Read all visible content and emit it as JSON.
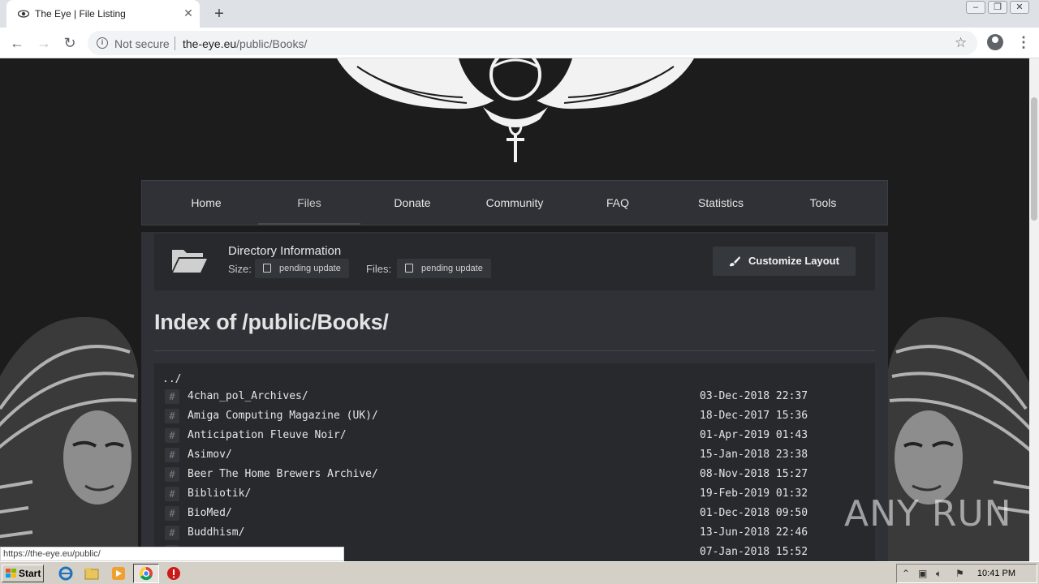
{
  "browser": {
    "tab_title": "The Eye | File Listing",
    "tab_close": "✕",
    "new_tab": "+",
    "address": {
      "security_label": "Not secure",
      "host": "the-eye.eu",
      "path": "/public/Books/"
    },
    "status_url": "https://the-eye.eu/public/"
  },
  "site": {
    "nav": [
      "Home",
      "Files",
      "Donate",
      "Community",
      "FAQ",
      "Statistics",
      "Tools"
    ],
    "active_nav": "Files",
    "directory_info": {
      "title": "Directory Information",
      "size_label": "Size:",
      "size_value": "pending update",
      "files_label": "Files:",
      "files_value": "pending update",
      "customize_label": "Customize Layout"
    },
    "index_title": "Index of /public/Books/",
    "parent_link": "../",
    "entries": [
      {
        "name": "4chan_pol_Archives/",
        "date": "03-Dec-2018 22:37"
      },
      {
        "name": "Amiga Computing Magazine (UK)/",
        "date": "18-Dec-2017 15:36"
      },
      {
        "name": "Anticipation Fleuve Noir/",
        "date": "01-Apr-2019 01:43"
      },
      {
        "name": "Asimov/",
        "date": "15-Jan-2018 23:38"
      },
      {
        "name": "Beer The Home Brewers Archive/",
        "date": "08-Nov-2018 15:27"
      },
      {
        "name": "Bibliotik/",
        "date": "19-Feb-2019 01:32"
      },
      {
        "name": "BioMed/",
        "date": "01-Dec-2018 09:50"
      },
      {
        "name": "Buddhism/",
        "date": "13-Jun-2018 22:46"
      },
      {
        "name": "",
        "date": "07-Jan-2018 15:52"
      }
    ]
  },
  "watermark": "ANY RUN",
  "taskbar": {
    "start_label": "Start",
    "clock": "10:41 PM"
  },
  "colors": {
    "page_bg": "#1c1c1d",
    "panel_bg": "#2f3136",
    "listing_bg": "#27292d"
  }
}
